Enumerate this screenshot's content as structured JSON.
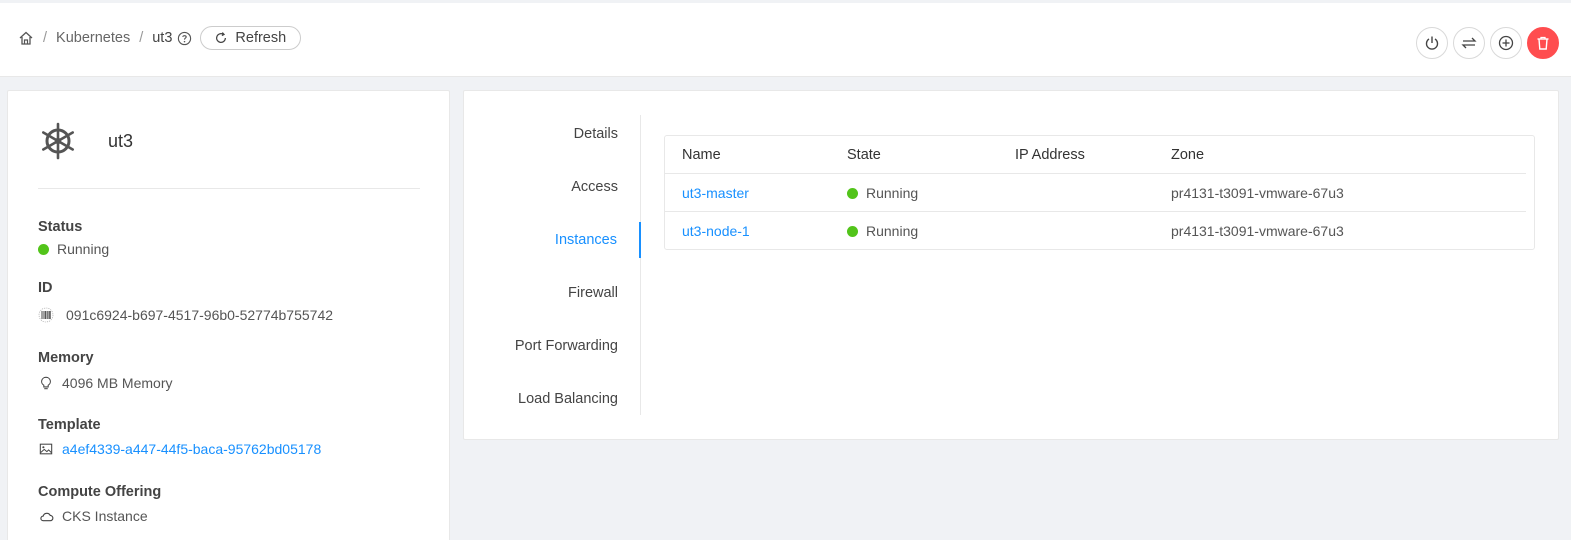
{
  "breadcrumb": {
    "home_icon": "home-icon",
    "separator": "/",
    "section": "Kubernetes",
    "current": "ut3",
    "refresh_label": "Refresh"
  },
  "actions": [
    {
      "name": "power-icon"
    },
    {
      "name": "swap-icon"
    },
    {
      "name": "plus-circle-icon"
    },
    {
      "name": "delete-icon"
    }
  ],
  "resource": {
    "name": "ut3",
    "logo_icon": "kubernetes-helm-icon"
  },
  "details": {
    "status": {
      "label": "Status",
      "value": "Running"
    },
    "id": {
      "label": "ID",
      "value": "091c6924-b697-4517-96b0-52774b755742"
    },
    "memory": {
      "label": "Memory",
      "value": "4096 MB Memory"
    },
    "template": {
      "label": "Template",
      "value": "a4ef4339-a447-44f5-baca-95762bd05178"
    },
    "compute": {
      "label": "Compute Offering",
      "value": "CKS Instance"
    }
  },
  "tabs": [
    "Details",
    "Access",
    "Instances",
    "Firewall",
    "Port Forwarding",
    "Load Balancing"
  ],
  "active_tab": "Instances",
  "table": {
    "columns": [
      "Name",
      "State",
      "IP Address",
      "Zone"
    ],
    "rows": [
      {
        "name": "ut3-master",
        "state": "Running",
        "ip": "",
        "zone": "pr4131-t3091-vmware-67u3"
      },
      {
        "name": "ut3-node-1",
        "state": "Running",
        "ip": "",
        "zone": "pr4131-t3091-vmware-67u3"
      }
    ]
  },
  "colors": {
    "accent": "#1890ff",
    "running": "#52c41a",
    "danger": "#ff4d4f"
  }
}
